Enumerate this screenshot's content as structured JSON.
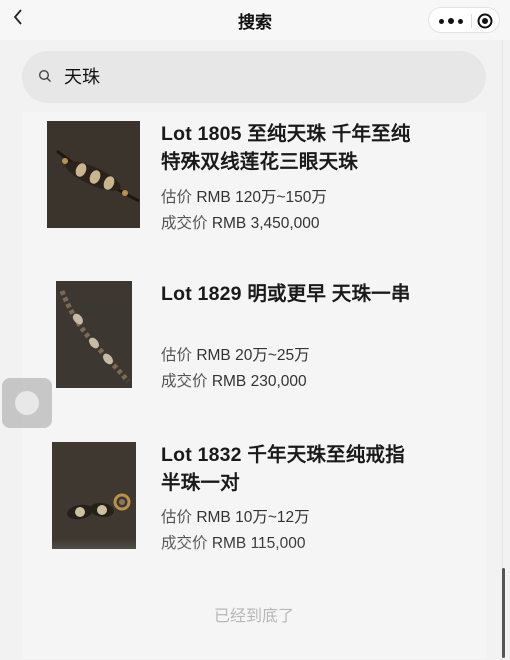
{
  "header": {
    "back_icon": "chevron-left-icon",
    "title": "搜索",
    "more_icon": "more-dots-icon",
    "close_icon": "target-close-icon"
  },
  "search": {
    "icon": "search-icon",
    "value": "天珠"
  },
  "results": [
    {
      "title_line1": "Lot 1805 至纯天珠 千年至纯",
      "title_line2": "特殊双线莲花三眼天珠",
      "estimate_label": "估价",
      "estimate_value": "RMB 120万~150万",
      "sold_label": "成交价",
      "sold_value": "RMB 3,450,000"
    },
    {
      "title_line1": "Lot 1829 明或更早 天珠一串",
      "title_line2": "",
      "estimate_label": "估价",
      "estimate_value": "RMB 20万~25万",
      "sold_label": "成交价",
      "sold_value": "RMB 230,000"
    },
    {
      "title_line1": "Lot 1832 千年天珠至纯戒指",
      "title_line2": "半珠一对",
      "estimate_label": "估价",
      "estimate_value": "RMB 10万~12万",
      "sold_label": "成交价",
      "sold_value": "RMB 115,000"
    }
  ],
  "footer": {
    "end_text": "已经到底了"
  },
  "colors": {
    "background": "#f2f2f2",
    "search_bg": "#e7e7e7",
    "thumb_bg": "#3a342e"
  }
}
